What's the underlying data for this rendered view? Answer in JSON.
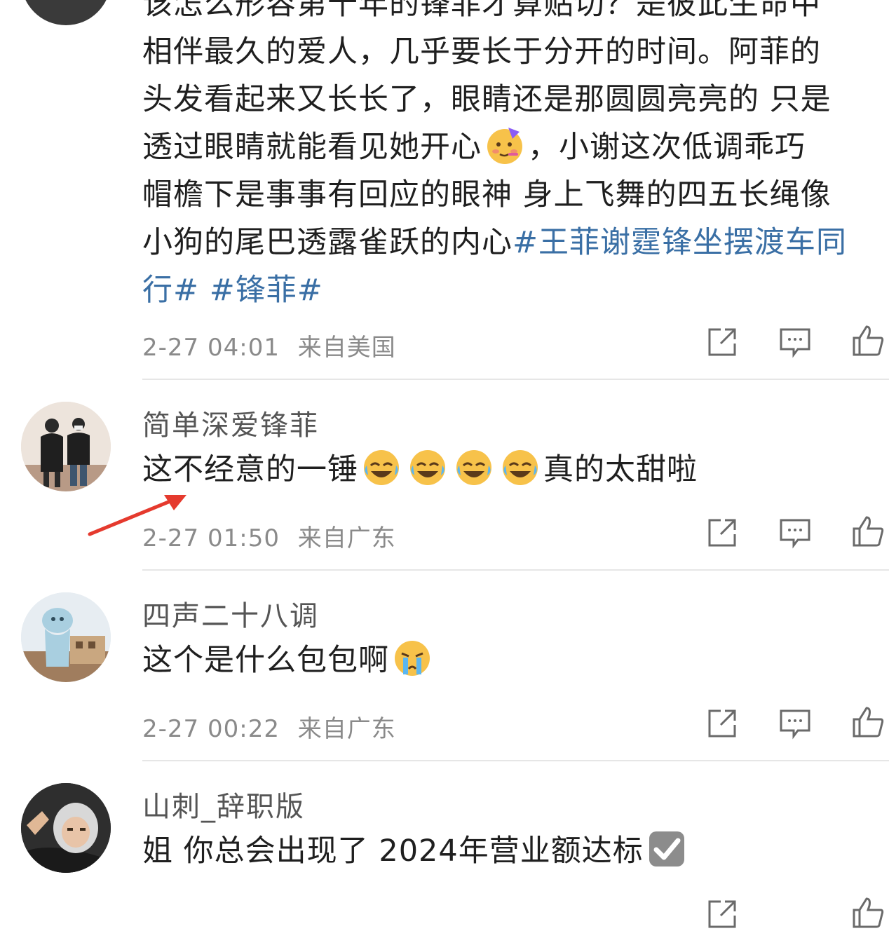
{
  "comment0": {
    "lines": [
      "该怎么形容第十年的锋菲才算贴切？是彼此生命中",
      "相伴最久的爱人，几乎要长于分开的时间。阿菲的",
      "头发看起来又长长了，眼睛还是那圆圆亮亮的 只是",
      "透过眼睛就能看见她开心",
      "，小谢这次低调乖巧",
      "帽檐下是事事有回应的眼神 身上飞舞的四五长绳像",
      "小狗的尾巴透露雀跃的内心",
      "#王菲谢霆锋坐摆渡车同",
      "行# #锋菲#"
    ],
    "timestamp": "2-27 04:01",
    "location": "来自美国"
  },
  "comment1": {
    "username": "简单深爱锋菲",
    "text_before": "这不经意的一锤",
    "text_after": "真的太甜啦",
    "emoji": [
      "laugh-cry-emoji",
      "laugh-cry-emoji",
      "laugh-cry-emoji",
      "laugh-cry-emoji"
    ],
    "timestamp": "2-27 01:50",
    "location": "来自广东"
  },
  "comment2": {
    "username": "四声二十八调",
    "text": "这个是什么包包啊",
    "emoji": "crying-emoji",
    "timestamp": "2-27 00:22",
    "location": "来自广东"
  },
  "comment3": {
    "username": "山刺_辞职版",
    "text": "姐 你总会出现了 2024年营业额达标",
    "emoji": "checkbox-emoji"
  },
  "colors": {
    "hashtag": "#3a6fa5",
    "meta": "#8a8a8a",
    "annotation_arrow": "#e53a2e",
    "divider": "#e6e6e6"
  },
  "icons": [
    "share-icon",
    "comment-icon",
    "like-icon"
  ]
}
